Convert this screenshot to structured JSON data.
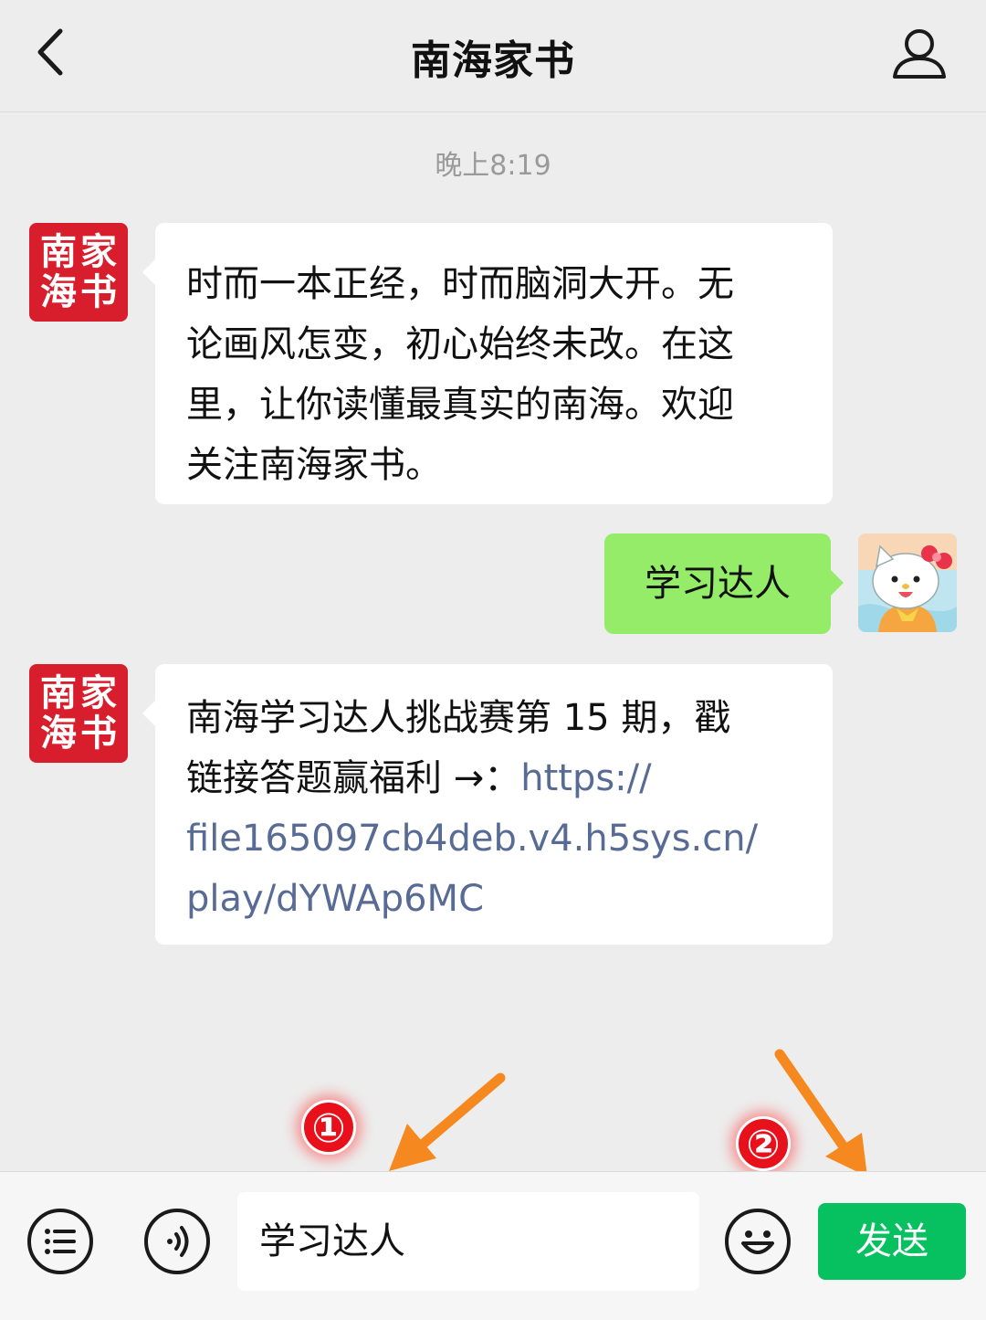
{
  "header": {
    "title": "南海家书",
    "back_icon": "chevron-left-icon",
    "profile_icon": "person-icon"
  },
  "chat": {
    "timestamp": "晚上8:19",
    "official_avatar": {
      "line1": "南海",
      "line2": "家书"
    },
    "messages": [
      {
        "from": "official",
        "lines": [
          "时而一本正经，时而脑洞大开。无",
          "论画风怎变，初心始终未改。在这",
          "里，让你读懂最真实的南海。欢迎",
          "关注南海家书。"
        ]
      },
      {
        "from": "me",
        "text": "学习达人"
      },
      {
        "from": "official",
        "line1": "南海学习达人挑战赛第 15 期，戳",
        "line2_text": "链接答题赢福利 →：",
        "line2_link": "https://",
        "line3": "file165097cb4deb.v4.h5sys.cn/",
        "line4": "play/dYWAp6MC"
      }
    ]
  },
  "annotations": {
    "marker1": "①",
    "marker2": "②",
    "arrow_color": "#f5891f"
  },
  "input_bar": {
    "value": "学习达人",
    "send_label": "发送",
    "send_color": "#07c160",
    "menu_icon": "list-icon",
    "voice_icon": "voice-icon",
    "emoji_icon": "smiley-icon"
  }
}
